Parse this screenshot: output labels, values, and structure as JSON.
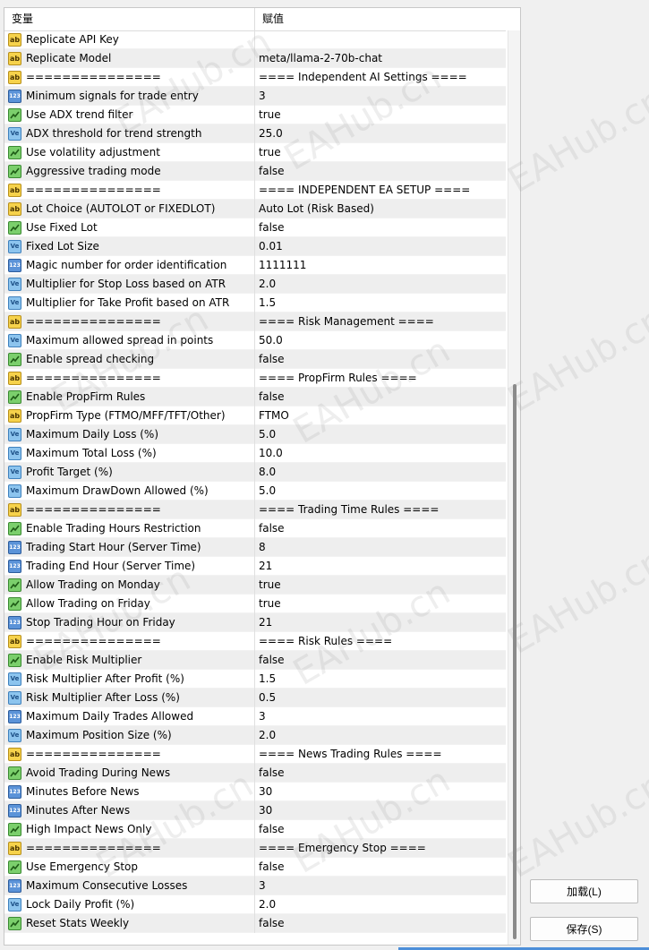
{
  "table": {
    "headers": {
      "variable": "变量",
      "value": "赋值"
    },
    "rows": [
      {
        "type": "ab",
        "name": "Replicate API Key",
        "value": ""
      },
      {
        "type": "ab",
        "name": "Replicate Model",
        "value": "meta/llama-2-70b-chat"
      },
      {
        "type": "ab",
        "name": "===============",
        "value": "==== Independent AI Settings ===="
      },
      {
        "type": "num",
        "name": "Minimum signals for trade entry",
        "value": "3"
      },
      {
        "type": "bool",
        "name": "Use ADX trend filter",
        "value": "true"
      },
      {
        "type": "dbl",
        "name": "ADX threshold for trend strength",
        "value": "25.0"
      },
      {
        "type": "bool",
        "name": "Use volatility adjustment",
        "value": "true"
      },
      {
        "type": "bool",
        "name": "Aggressive trading mode",
        "value": "false"
      },
      {
        "type": "ab",
        "name": "===============",
        "value": "==== INDEPENDENT EA SETUP ===="
      },
      {
        "type": "ab",
        "name": "Lot Choice (AUTOLOT or FIXEDLOT)",
        "value": "Auto Lot (Risk Based)"
      },
      {
        "type": "bool",
        "name": "Use Fixed Lot",
        "value": "false"
      },
      {
        "type": "dbl",
        "name": "Fixed Lot Size",
        "value": "0.01"
      },
      {
        "type": "num",
        "name": "Magic number for order identification",
        "value": "1111111"
      },
      {
        "type": "dbl",
        "name": "Multiplier for Stop Loss based on ATR",
        "value": "2.0"
      },
      {
        "type": "dbl",
        "name": "Multiplier for Take Profit based on ATR",
        "value": "1.5"
      },
      {
        "type": "ab",
        "name": "===============",
        "value": "==== Risk Management ===="
      },
      {
        "type": "dbl",
        "name": "Maximum allowed spread in points",
        "value": "50.0"
      },
      {
        "type": "bool",
        "name": "Enable spread checking",
        "value": "false"
      },
      {
        "type": "ab",
        "name": "===============",
        "value": "==== PropFirm Rules ===="
      },
      {
        "type": "bool",
        "name": "Enable PropFirm Rules",
        "value": "false"
      },
      {
        "type": "ab",
        "name": "PropFirm Type (FTMO/MFF/TFT/Other)",
        "value": "FTMO"
      },
      {
        "type": "dbl",
        "name": "Maximum Daily Loss (%)",
        "value": "5.0"
      },
      {
        "type": "dbl",
        "name": "Maximum Total Loss (%)",
        "value": "10.0"
      },
      {
        "type": "dbl",
        "name": "Profit Target (%)",
        "value": "8.0"
      },
      {
        "type": "dbl",
        "name": "Maximum DrawDown Allowed (%)",
        "value": "5.0"
      },
      {
        "type": "ab",
        "name": "===============",
        "value": "==== Trading Time Rules ===="
      },
      {
        "type": "bool",
        "name": "Enable Trading Hours Restriction",
        "value": "false"
      },
      {
        "type": "num",
        "name": "Trading Start Hour (Server Time)",
        "value": "8"
      },
      {
        "type": "num",
        "name": "Trading End Hour (Server Time)",
        "value": "21"
      },
      {
        "type": "bool",
        "name": "Allow Trading on Monday",
        "value": "true"
      },
      {
        "type": "bool",
        "name": "Allow Trading on Friday",
        "value": "true"
      },
      {
        "type": "num",
        "name": "Stop Trading Hour on Friday",
        "value": "21"
      },
      {
        "type": "ab",
        "name": "===============",
        "value": "==== Risk Rules ===="
      },
      {
        "type": "bool",
        "name": "Enable Risk Multiplier",
        "value": "false"
      },
      {
        "type": "dbl",
        "name": "Risk Multiplier After Profit (%)",
        "value": "1.5"
      },
      {
        "type": "dbl",
        "name": "Risk Multiplier After Loss (%)",
        "value": "0.5"
      },
      {
        "type": "num",
        "name": "Maximum Daily Trades Allowed",
        "value": "3"
      },
      {
        "type": "dbl",
        "name": "Maximum Position Size (%)",
        "value": "2.0"
      },
      {
        "type": "ab",
        "name": "===============",
        "value": "==== News Trading Rules ===="
      },
      {
        "type": "bool",
        "name": "Avoid Trading During News",
        "value": "false"
      },
      {
        "type": "num",
        "name": "Minutes Before News",
        "value": "30"
      },
      {
        "type": "num",
        "name": "Minutes After News",
        "value": "30"
      },
      {
        "type": "bool",
        "name": "High Impact News Only",
        "value": "false"
      },
      {
        "type": "ab",
        "name": "===============",
        "value": "==== Emergency Stop ===="
      },
      {
        "type": "bool",
        "name": "Use Emergency Stop",
        "value": "false"
      },
      {
        "type": "num",
        "name": "Maximum Consecutive Losses",
        "value": "3"
      },
      {
        "type": "dbl",
        "name": "Lock Daily Profit (%)",
        "value": "2.0"
      },
      {
        "type": "bool",
        "name": "Reset Stats Weekly",
        "value": "false"
      }
    ]
  },
  "icons": {
    "ab": {
      "name": "string-type-icon",
      "glyph": "ab"
    },
    "num": {
      "name": "integer-type-icon",
      "glyph": "123"
    },
    "dbl": {
      "name": "double-type-icon",
      "glyph": "Ve"
    },
    "bool": {
      "name": "boolean-type-icon",
      "glyph": ""
    }
  },
  "buttons": {
    "load_label": "加载(L)",
    "save_label": "保存(S)"
  },
  "watermark_text": "EAHub.cn"
}
